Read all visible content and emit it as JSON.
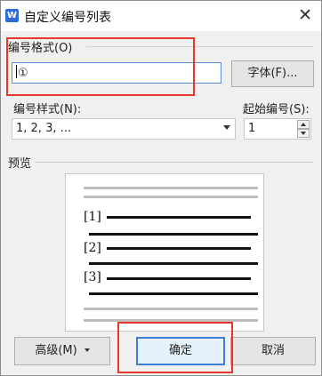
{
  "window": {
    "app_icon": "W",
    "title": "自定义编号列表",
    "close_glyph": "✕"
  },
  "number_format": {
    "label": "编号格式(O)",
    "value": "①",
    "font_button": "字体(F)..."
  },
  "number_style": {
    "label": "编号样式(N):",
    "selected": "1, 2, 3, ..."
  },
  "start_number": {
    "label": "起始编号(S):",
    "value": "1"
  },
  "preview": {
    "label": "预览",
    "items": [
      "[1]",
      "[2]",
      "[3]"
    ]
  },
  "buttons": {
    "advanced": "高级(M)",
    "ok": "确定",
    "cancel": "取消"
  },
  "colors": {
    "highlight": "#e8372a",
    "focus": "#3c7fd8",
    "dialog_bg": "#f0f0f0"
  },
  "icons": {
    "app": "wps-writer-icon",
    "close": "close-icon",
    "dropdown": "chevron-down-icon"
  }
}
